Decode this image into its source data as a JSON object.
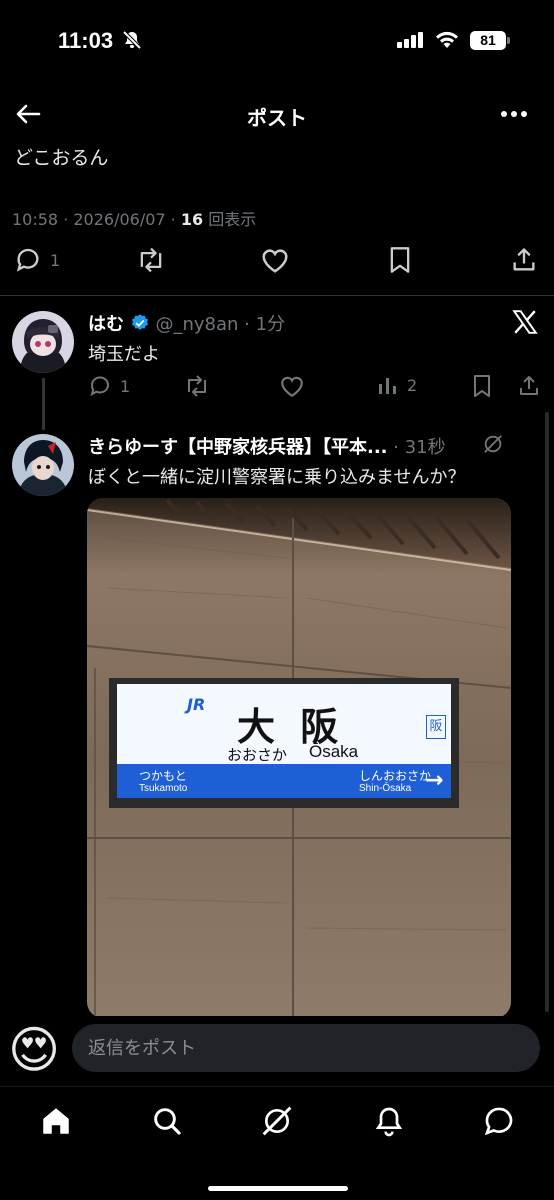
{
  "status_bar": {
    "time": "11:03",
    "battery": "81"
  },
  "header": {
    "title": "ポスト"
  },
  "post": {
    "text": "どこおるん",
    "timestamp": "10:58 · 2026/06/07 · ",
    "views_count": "16",
    "views_label": " 回表示",
    "reply_count": "1"
  },
  "replies": [
    {
      "name": "はむ",
      "handle": "@_ny8an · 1分",
      "text": "埼玉だよ",
      "reply_count": "1",
      "view_count": "2"
    },
    {
      "name": "きらゆーす【中野家核兵器】【平本...",
      "handle": "· 31秒",
      "text": "ぼくと一緒に淀川警察署に乗り込みませんか？"
    }
  ],
  "photo": {
    "logo": "JR",
    "station_kanji": "大 阪",
    "station_kana": "おおさか",
    "station_romaji": "Ōsaka",
    "side_kanji": "阪",
    "prev_kana": "つかもと",
    "prev_romaji": "Tsukamoto",
    "next_kana": "しんおおさか",
    "next_romaji": "Shin-Ōsaka",
    "next_arrow": "→"
  },
  "reply_bar": {
    "emoji": "😍",
    "placeholder": "返信をポスト"
  },
  "colors": {
    "background": "#000000",
    "text": "#e7e9ea",
    "muted": "#71767b",
    "verified": "#1d9bf0",
    "sign_blue": "#1f5fd6"
  },
  "icons": [
    "mute-icon",
    "signal-icon",
    "wifi-icon",
    "back-icon",
    "more-icon",
    "reply-icon",
    "repost-icon",
    "like-icon",
    "bookmark-icon",
    "share-icon",
    "verified-icon",
    "x-logo-icon",
    "views-icon",
    "grok-icon",
    "home-icon",
    "search-icon",
    "grok-tab-icon",
    "bell-icon",
    "messages-icon"
  ]
}
